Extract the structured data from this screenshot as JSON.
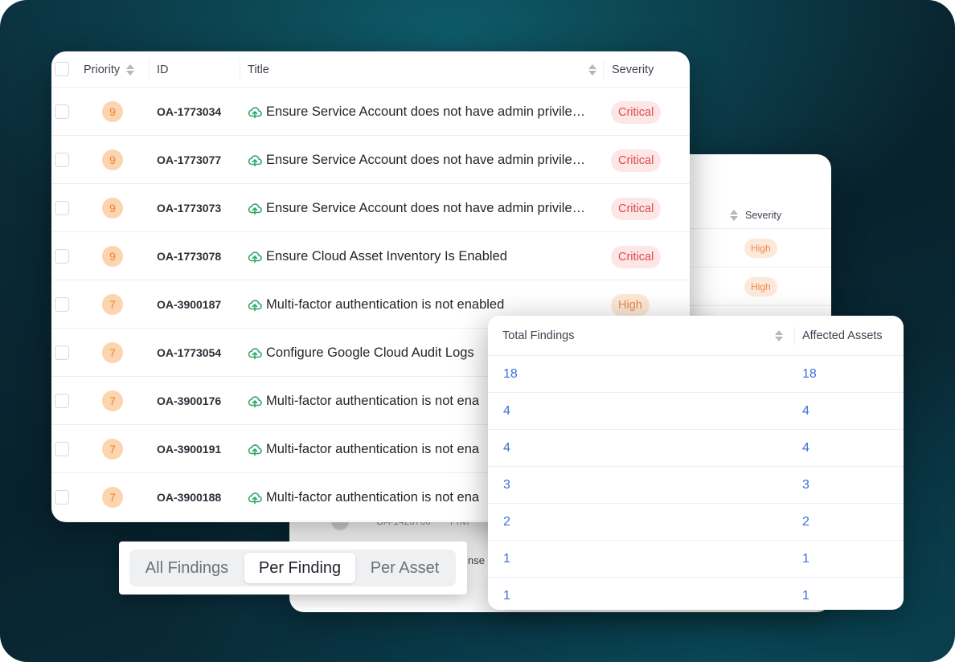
{
  "colors": {
    "critical_text": "#e0494f",
    "critical_bg": "#fde6e6",
    "high_text": "#f0894a",
    "high_bg": "#fde8d6",
    "priority_bg": "#fcd5ae",
    "link_blue": "#3b6fd8",
    "cloud_icon": "#2fa46a"
  },
  "findings_table": {
    "columns": {
      "priority": "Priority",
      "id": "ID",
      "title": "Title",
      "severity": "Severity"
    },
    "rows": [
      {
        "priority": "9",
        "id": "OA-1773034",
        "title": "Ensure Service Account does not have admin privile…",
        "severity": "Critical",
        "icon": "cloud-upload-icon"
      },
      {
        "priority": "9",
        "id": "OA-1773077",
        "title": "Ensure Service Account does not have admin privile…",
        "severity": "Critical",
        "icon": "cloud-upload-icon"
      },
      {
        "priority": "9",
        "id": "OA-1773073",
        "title": "Ensure Service Account does not have admin privile…",
        "severity": "Critical",
        "icon": "cloud-upload-icon"
      },
      {
        "priority": "9",
        "id": "OA-1773078",
        "title": "Ensure Cloud Asset Inventory Is Enabled",
        "severity": "Critical",
        "icon": "cloud-upload-icon"
      },
      {
        "priority": "7",
        "id": "OA-3900187",
        "title": "Multi-factor authentication is not enabled",
        "severity": "High",
        "icon": "cloud-upload-icon"
      },
      {
        "priority": "7",
        "id": "OA-1773054",
        "title": "Configure Google Cloud Audit Logs",
        "severity": "",
        "icon": "cloud-upload-icon"
      },
      {
        "priority": "7",
        "id": "OA-3900176",
        "title": "Multi-factor authentication is not ena",
        "severity": "",
        "icon": "cloud-upload-icon"
      },
      {
        "priority": "7",
        "id": "OA-3900191",
        "title": "Multi-factor authentication is not ena",
        "severity": "",
        "icon": "cloud-upload-icon"
      },
      {
        "priority": "7",
        "id": "OA-3900188",
        "title": "Multi-factor authentication is not ena",
        "severity": "",
        "icon": "cloud-upload-icon"
      }
    ]
  },
  "back_table": {
    "severity_header": "Severity",
    "badges": [
      "High",
      "High"
    ],
    "fragment_id": "OA-1420700",
    "fragment_title": "Privi",
    "fragment_text": "nse"
  },
  "totals_table": {
    "columns": {
      "total": "Total Findings",
      "affected": "Affected Assets"
    },
    "rows": [
      {
        "total": "18",
        "affected": "18"
      },
      {
        "total": "4",
        "affected": "4"
      },
      {
        "total": "4",
        "affected": "4"
      },
      {
        "total": "3",
        "affected": "3"
      },
      {
        "total": "2",
        "affected": "2"
      },
      {
        "total": "1",
        "affected": "1"
      },
      {
        "total": "1",
        "affected": "1"
      }
    ]
  },
  "view_switch": {
    "options": [
      "All Findings",
      "Per Finding",
      "Per Asset"
    ],
    "selected": "Per Finding"
  }
}
